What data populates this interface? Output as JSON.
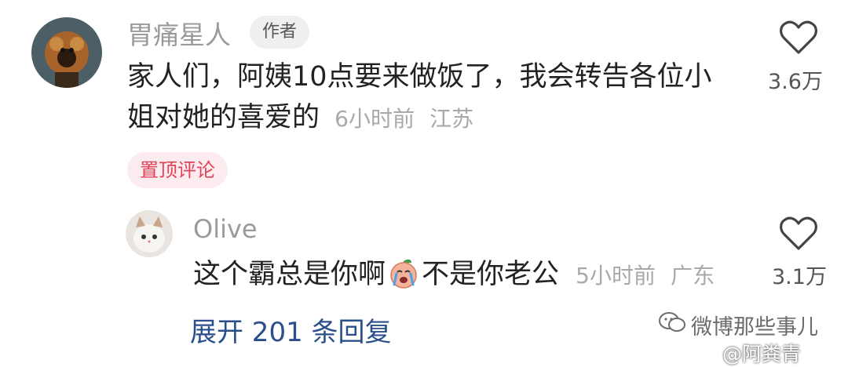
{
  "comment": {
    "username": "胃痛星人",
    "badge": "作者",
    "text_line1": "家人们，阿姨10点要来做饭了，我会转告各位小",
    "text_line2": "姐对她的喜爱的",
    "time": "6小时前",
    "location": "江苏",
    "pinned_label": "置顶评论",
    "like_count": "3.6万"
  },
  "reply": {
    "username": "Olive",
    "text_before_emoji": "这个霸总是你啊",
    "emoji": "crying-peach-emoji",
    "text_after_emoji": "不是你老公",
    "time": "5小时前",
    "location": "广东",
    "like_count": "3.1万"
  },
  "expand_label": "展开 201 条回复",
  "watermarks": {
    "line1": "微博那些事儿",
    "line2": "@阿粪青"
  },
  "colors": {
    "pinned_text": "#e04358",
    "pinned_bg": "#fdecef",
    "expand_link": "#2b4f8c"
  }
}
